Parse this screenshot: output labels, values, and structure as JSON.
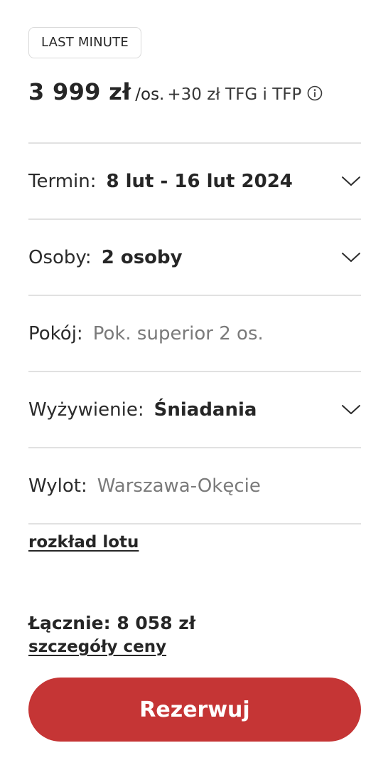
{
  "offer": {
    "badge": "LAST MINUTE",
    "price": "3 999 zł",
    "price_unit": "/os.",
    "price_extra": "+30 zł TFG i TFP",
    "info_icon": "info-circle-icon"
  },
  "fields": {
    "term": {
      "label": "Termin:",
      "value": "8 lut - 16 lut 2024",
      "icon": "chevron-down-icon"
    },
    "persons": {
      "label": "Osoby:",
      "value": "2 osoby",
      "icon": "chevron-down-icon"
    },
    "room": {
      "label": "Pokój:",
      "value": "Pok. superior 2 os."
    },
    "board": {
      "label": "Wyżywienie:",
      "value": "Śniadania",
      "icon": "chevron-down-icon"
    },
    "departure": {
      "label": "Wylot:",
      "value": "Warszawa-Okęcie"
    }
  },
  "links": {
    "flight_schedule": "rozkład lotu",
    "price_details": "szczegóły ceny"
  },
  "summary": {
    "total": "Łącznie: 8 058 zł"
  },
  "actions": {
    "book": "Rezerwuj"
  },
  "colors": {
    "accent": "#c53535",
    "divider": "#e1e1e1",
    "muted_text": "#7a7a7a"
  }
}
